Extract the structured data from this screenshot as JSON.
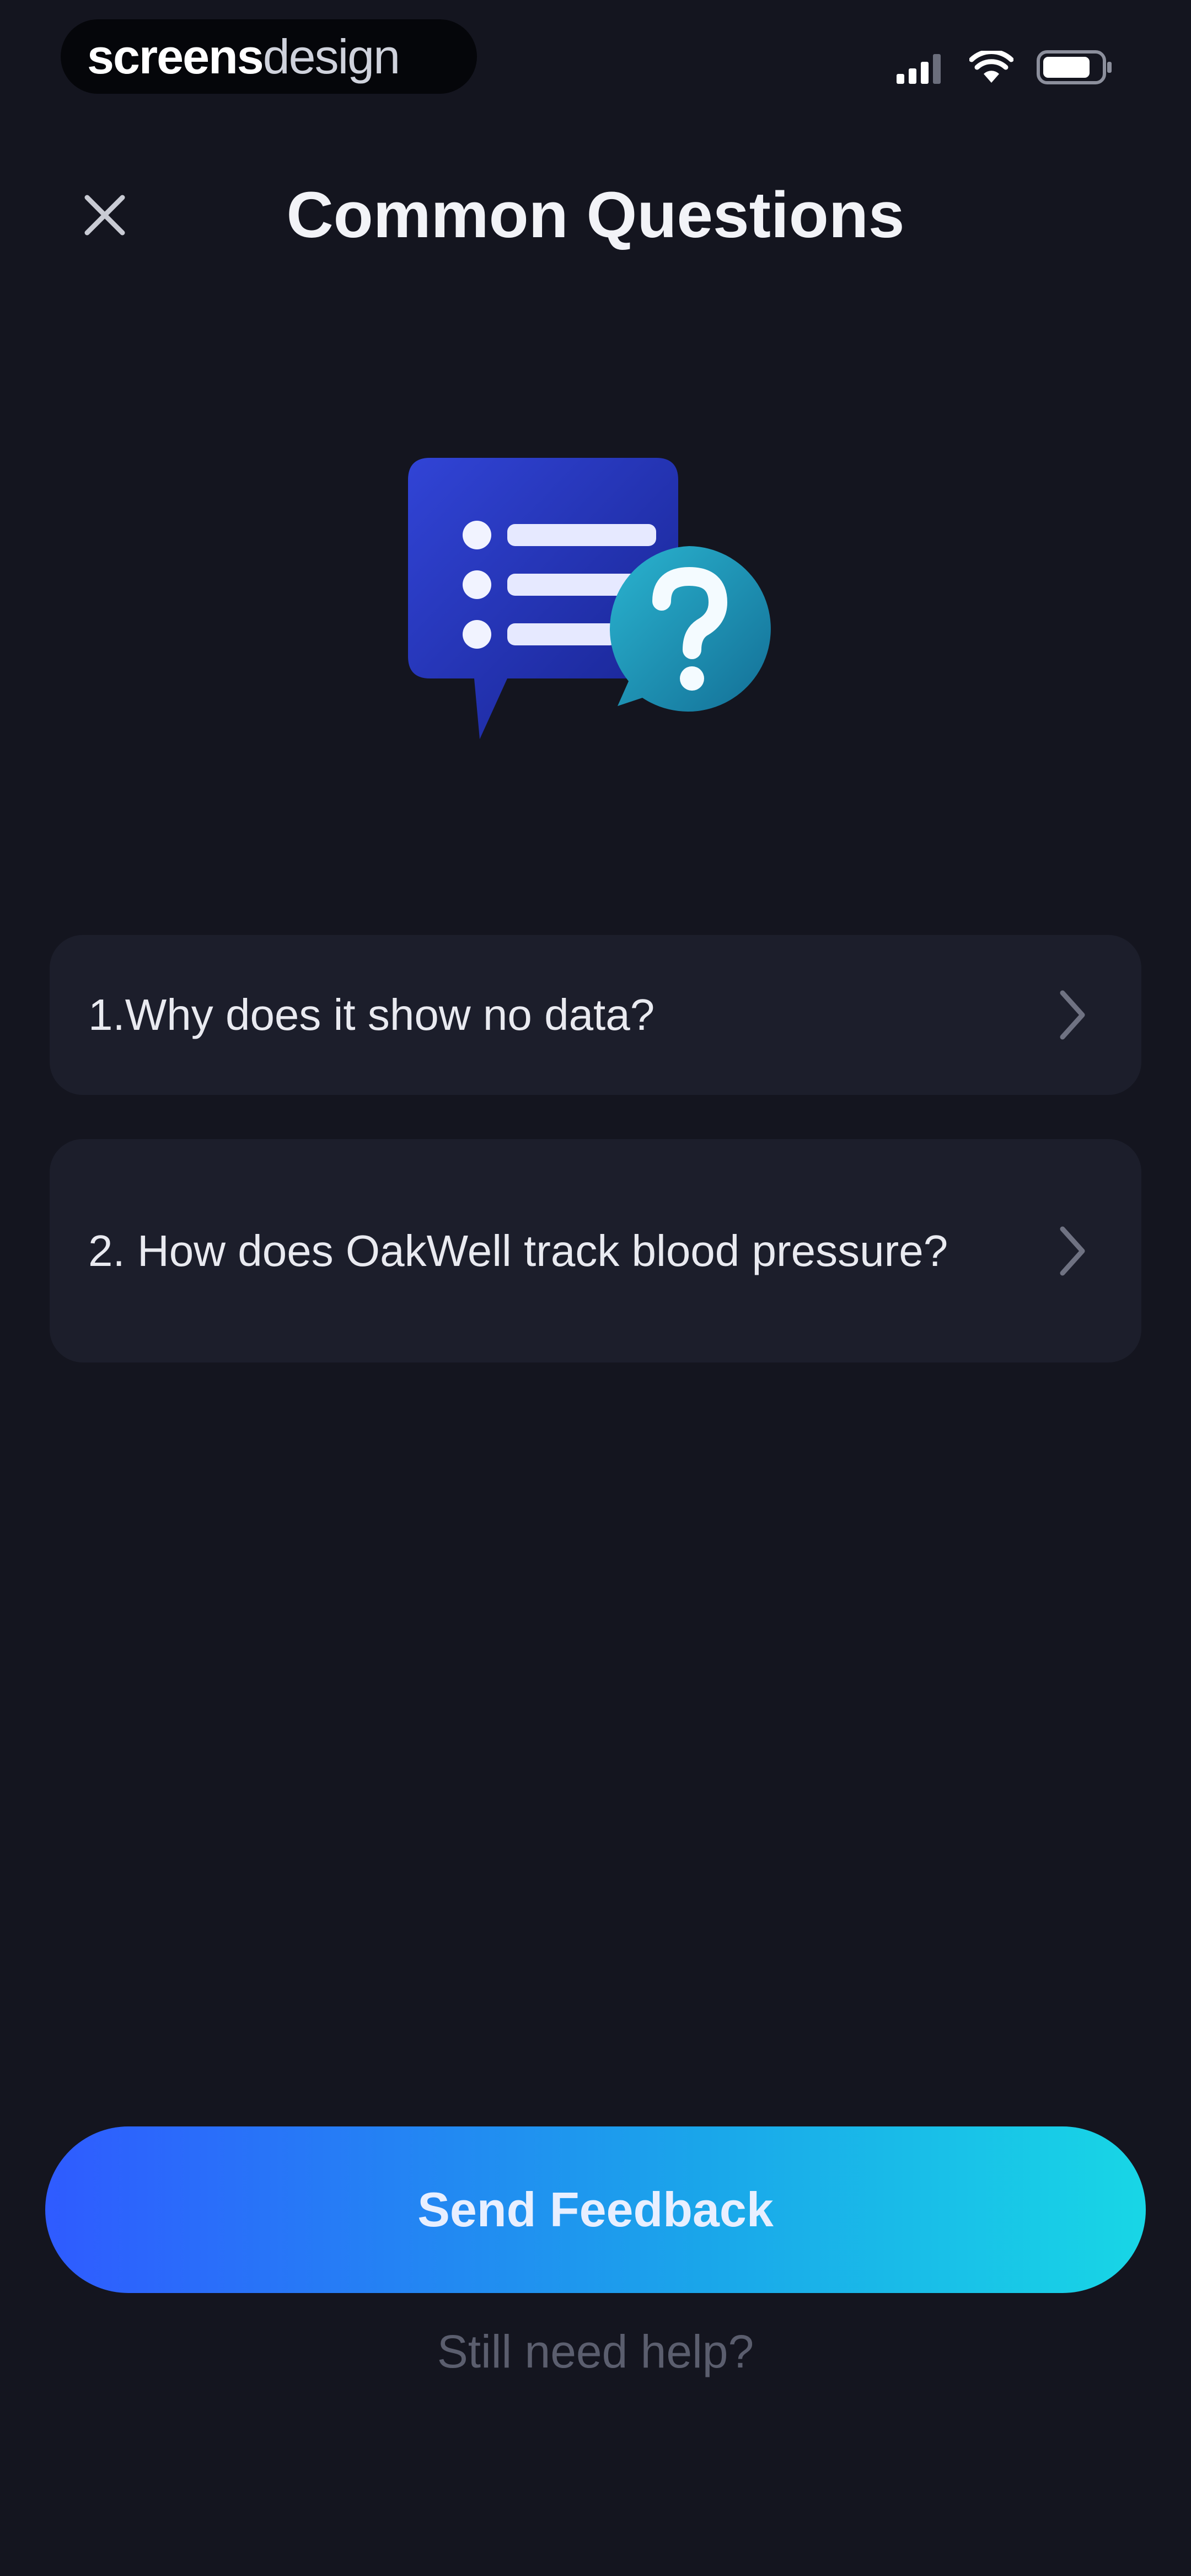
{
  "status_bar": {
    "brand_bold": "screens",
    "brand_light": "design",
    "icons": [
      "signal-icon",
      "wifi-icon",
      "battery-icon"
    ]
  },
  "header": {
    "title": "Common Questions",
    "close_icon": "close-icon"
  },
  "illustration": {
    "icon": "faq-chat-bubbles-icon",
    "colors": {
      "list_bubble": "#2332b8",
      "question_bubble": "#1b8fb0"
    }
  },
  "faq": {
    "items": [
      {
        "label": "1.Why does it show no data?"
      },
      {
        "label": "2. How does OakWell track blood pressure?"
      }
    ],
    "chevron_icon": "chevron-right-icon"
  },
  "actions": {
    "send_feedback_label": "Send Feedback",
    "help_link_label": "Still need help?"
  },
  "colors": {
    "background": "#14151f",
    "card": "#1c1e2b",
    "gradient_start": "#2f5bff",
    "gradient_end": "#18d6e6"
  }
}
